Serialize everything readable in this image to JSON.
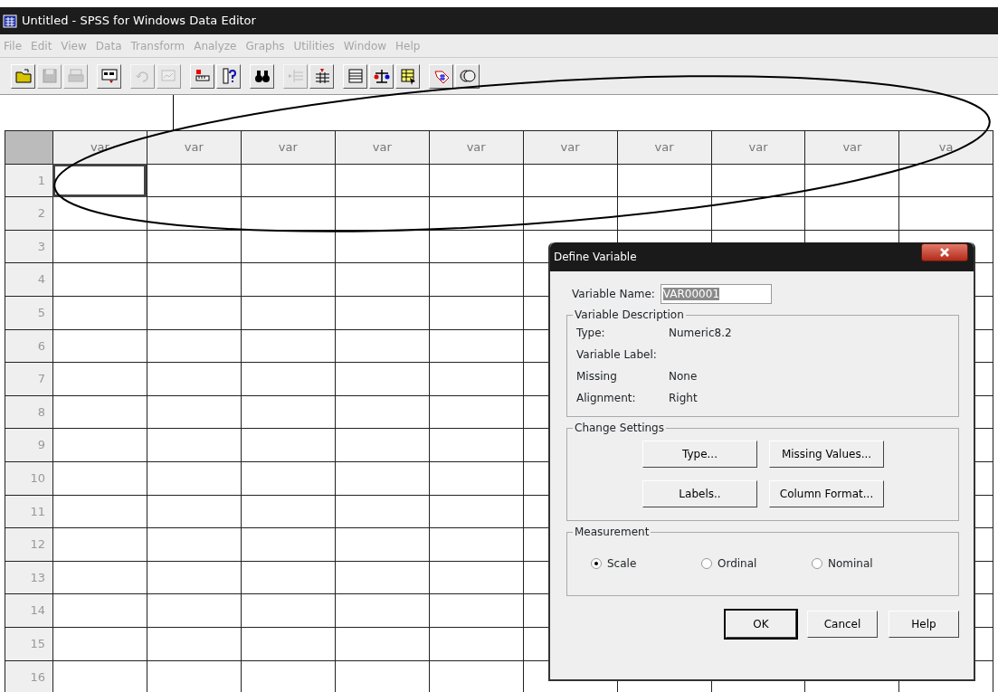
{
  "window": {
    "title": "Untitled - SPSS for Windows Data Editor"
  },
  "menu": [
    {
      "label": "File"
    },
    {
      "label": "Edit"
    },
    {
      "label": "View"
    },
    {
      "label": "Data"
    },
    {
      "label": "Transform"
    },
    {
      "label": "Analyze"
    },
    {
      "label": "Graphs"
    },
    {
      "label": "Utilities"
    },
    {
      "label": "Window"
    },
    {
      "label": "Help"
    }
  ],
  "toolbar": [
    {
      "buttons": [
        {
          "kind": "folder",
          "disabled": false
        },
        {
          "kind": "floppy",
          "disabled": true
        },
        {
          "kind": "printer",
          "disabled": true
        }
      ]
    },
    {
      "buttons": [
        {
          "kind": "dialog",
          "disabled": false
        }
      ]
    },
    {
      "buttons": [
        {
          "kind": "undo",
          "disabled": true
        },
        {
          "kind": "chart",
          "disabled": true
        }
      ]
    },
    {
      "buttons": [
        {
          "kind": "ruler",
          "disabled": false
        },
        {
          "kind": "question",
          "disabled": false
        }
      ]
    },
    {
      "buttons": [
        {
          "kind": "binoculars",
          "disabled": false
        }
      ]
    },
    {
      "buttons": [
        {
          "kind": "rows",
          "disabled": true
        },
        {
          "kind": "columns",
          "disabled": false
        }
      ]
    },
    {
      "buttons": [
        {
          "kind": "grid",
          "disabled": false
        },
        {
          "kind": "scale",
          "disabled": false
        },
        {
          "kind": "select",
          "disabled": false
        }
      ]
    },
    {
      "buttons": [
        {
          "kind": "tag",
          "disabled": false
        },
        {
          "kind": "circles",
          "disabled": false
        }
      ]
    }
  ],
  "table": {
    "columns": [
      {
        "label": "var",
        "selected": true
      },
      {
        "label": "var",
        "selected": false
      },
      {
        "label": "var",
        "selected": false
      },
      {
        "label": "var",
        "selected": false
      },
      {
        "label": "var",
        "selected": false
      },
      {
        "label": "var",
        "selected": false
      },
      {
        "label": "var",
        "selected": false
      },
      {
        "label": "var",
        "selected": false
      },
      {
        "label": "var",
        "selected": false
      },
      {
        "label": "va",
        "selected": false
      }
    ],
    "rows": [
      {
        "label": "1",
        "selected": true
      },
      {
        "label": "2",
        "selected": false
      },
      {
        "label": "3",
        "selected": false
      },
      {
        "label": "4",
        "selected": false
      },
      {
        "label": "5",
        "selected": false
      },
      {
        "label": "6",
        "selected": false
      },
      {
        "label": "7",
        "selected": false
      },
      {
        "label": "8",
        "selected": false
      },
      {
        "label": "9",
        "selected": false
      },
      {
        "label": "10",
        "selected": false
      },
      {
        "label": "11",
        "selected": false
      },
      {
        "label": "12",
        "selected": false
      },
      {
        "label": "13",
        "selected": false
      },
      {
        "label": "14",
        "selected": false
      },
      {
        "label": "15",
        "selected": false
      },
      {
        "label": "16",
        "selected": false
      }
    ]
  },
  "dialog": {
    "title": "Define Variable",
    "variable_name": {
      "label": "Variable Name:",
      "value": "VAR00001"
    },
    "description": {
      "title": "Variable Description",
      "rows": [
        {
          "label": "Type:",
          "value": "Numeric8.2"
        },
        {
          "label": "Variable Label:"
        },
        {
          "label": "Missing",
          "value": "None"
        },
        {
          "label": "Alignment:",
          "value": "Right"
        }
      ]
    },
    "change_settings": {
      "title": "Change Settings",
      "buttons": [
        {
          "label": "Type..."
        },
        {
          "label": "Missing Values..."
        },
        {
          "label": "Labels.."
        },
        {
          "label": "Column Format..."
        }
      ]
    },
    "measurement": {
      "title": "Measurement",
      "options": [
        {
          "label": "Scale",
          "selected": true
        },
        {
          "label": "Ordinal",
          "selected": false
        },
        {
          "label": "Nominal",
          "selected": false
        }
      ]
    },
    "buttons": [
      {
        "label": "OK",
        "default": true
      },
      {
        "label": "Cancel",
        "default": false
      },
      {
        "label": "Help",
        "default": false
      }
    ]
  },
  "annotation": {
    "kind": "ellipse"
  }
}
